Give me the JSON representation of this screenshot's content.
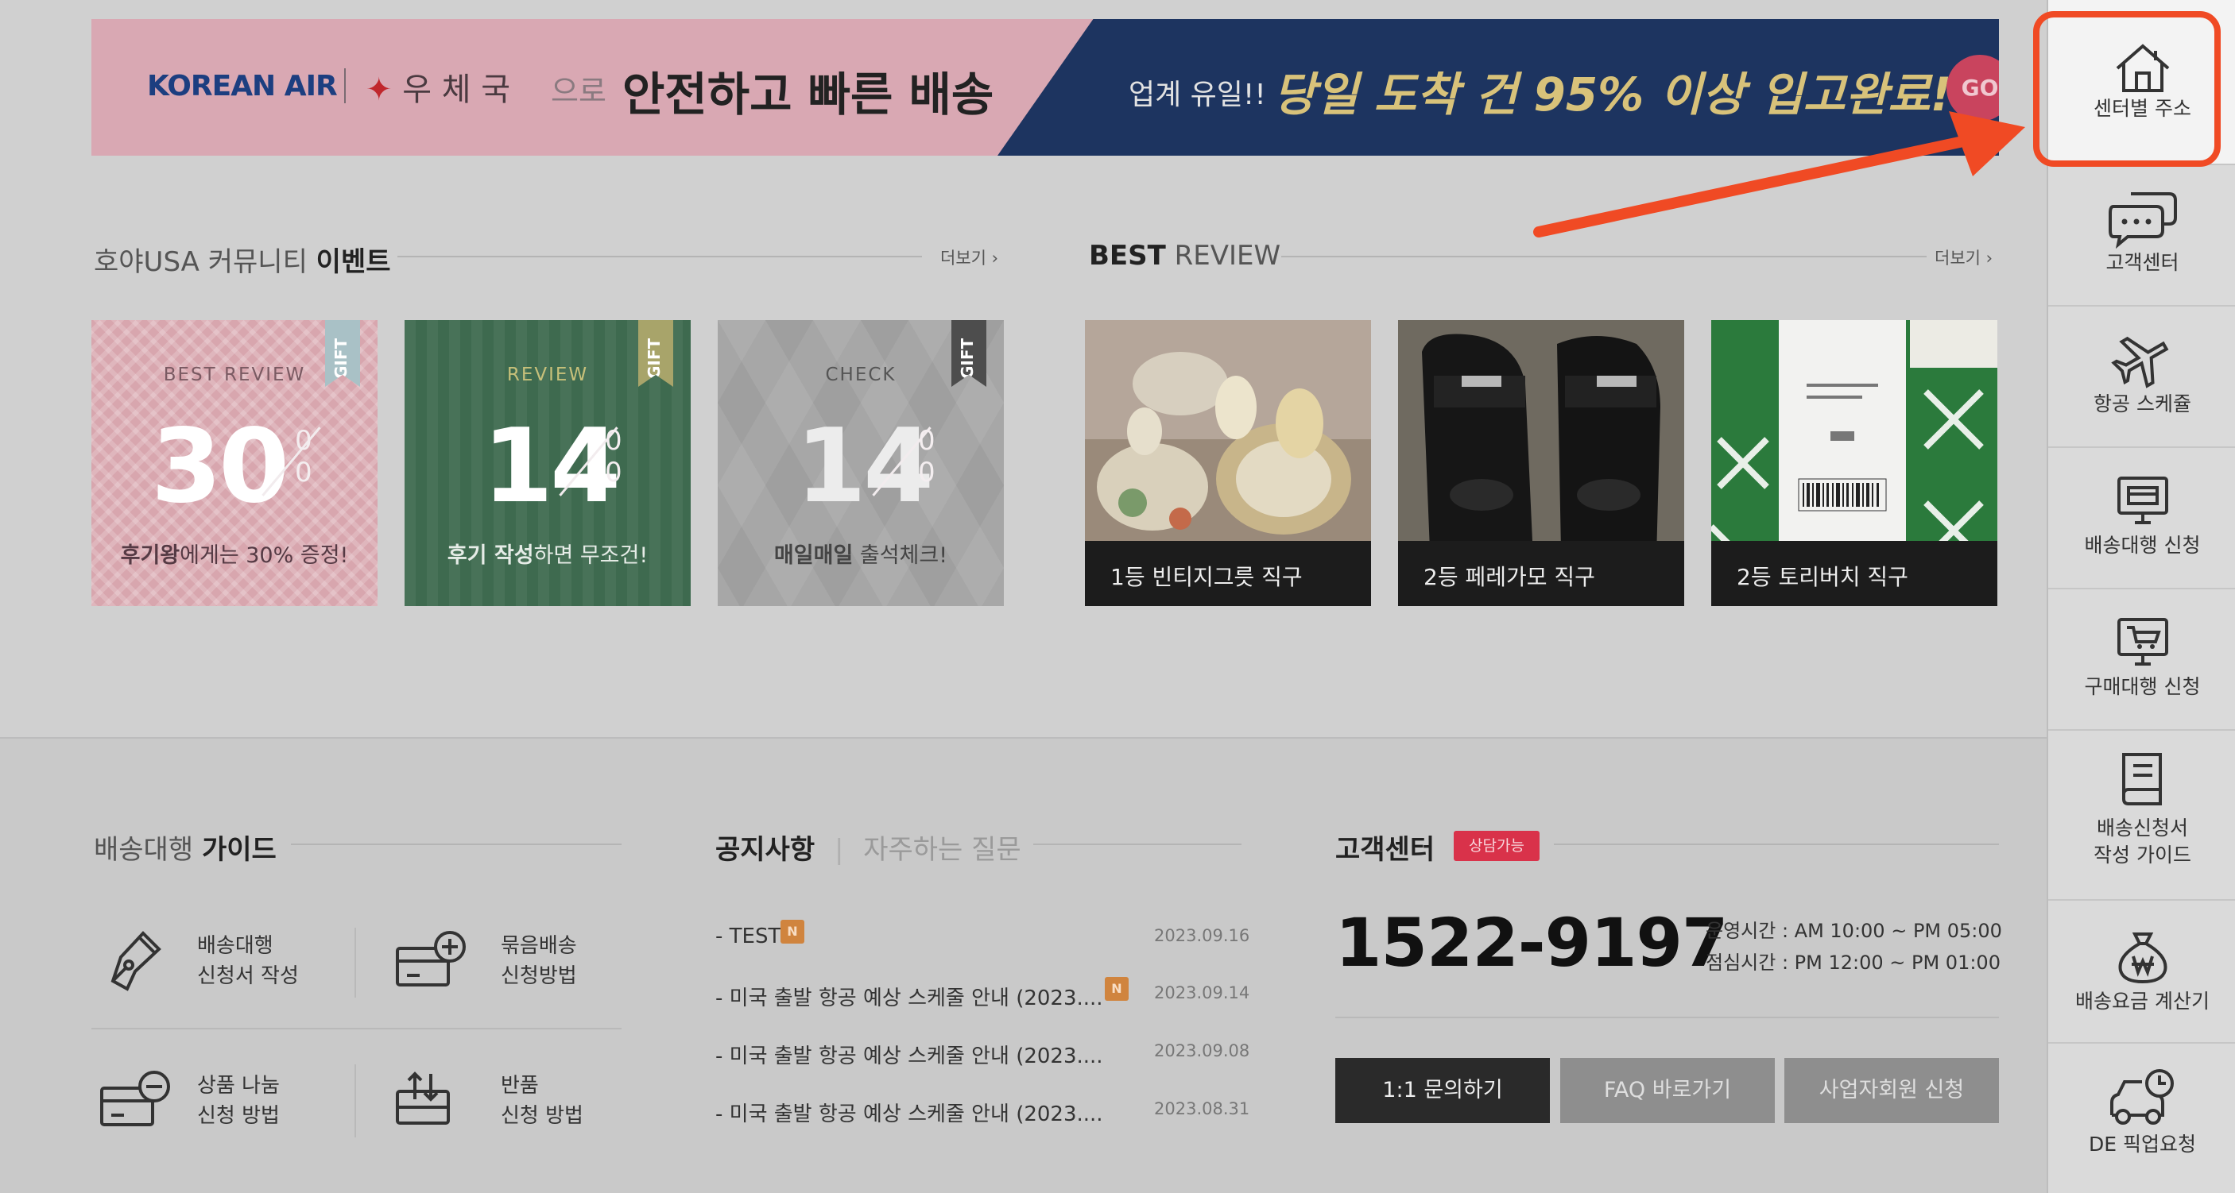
{
  "banner": {
    "korean_air": "KOREAN AIR",
    "post": "우 체 국",
    "euro": "으로",
    "safe": "안전하고 빠른 배송",
    "right_small": "업계 유일!!",
    "right_big": "당일 도착 건 95% 이상 입고완료!",
    "go": "GO"
  },
  "events": {
    "title_light": "호야USA 커뮤니티",
    "title_bold": "이벤트",
    "more": "더보기 ›",
    "cards": [
      {
        "ribbon": "GIFT",
        "top": "BEST REVIEW",
        "big": "30",
        "pct": "0 0",
        "bold": "후기왕",
        "rest": "에게는 30% 증정!"
      },
      {
        "ribbon": "GIFT",
        "top": "REVIEW",
        "big": "14",
        "pct": "0 0",
        "bold": "후기 작성",
        "rest": "하면 무조건!"
      },
      {
        "ribbon": "GIFT",
        "top": "CHECK",
        "big": "14",
        "pct": "0 0",
        "bold": "매일매일",
        "rest": " 출석체크!"
      }
    ]
  },
  "review": {
    "title_bold": "BEST",
    "title_light": "REVIEW",
    "more": "더보기 ›",
    "items": [
      {
        "caption": "1등 빈티지그릇 직구"
      },
      {
        "caption": "2등 페레가모 직구"
      },
      {
        "caption": "2등 토리버치 직구"
      }
    ]
  },
  "sidebar": {
    "items": [
      {
        "label": "센터별 주소",
        "icon": "home-icon"
      },
      {
        "label": "고객센터",
        "icon": "chat-bubble-icon"
      },
      {
        "label": "항공 스케쥴",
        "icon": "airplane-icon"
      },
      {
        "label": "배송대행 신청",
        "icon": "monitor-box-icon"
      },
      {
        "label": "구매대행 신청",
        "icon": "monitor-cart-icon"
      },
      {
        "label1": "배송신청서",
        "label2": "작성 가이드",
        "icon": "book-icon"
      },
      {
        "label": "배송요금 계산기",
        "icon": "money-bag-icon"
      },
      {
        "label": "DE 픽업요청",
        "icon": "pickup-car-icon"
      }
    ]
  },
  "guide": {
    "title_light": "배송대행",
    "title_bold": "가이드",
    "items": [
      {
        "l1": "배송대행",
        "l2": "신청서 작성",
        "icon": "pen-nib-icon"
      },
      {
        "l1": "묶음배송",
        "l2": "신청방법",
        "icon": "box-plus-icon"
      },
      {
        "l1": "상품 나눔",
        "l2": "신청 방법",
        "icon": "box-minus-icon"
      },
      {
        "l1": "반품",
        "l2": "신청 방법",
        "icon": "return-box-icon"
      }
    ]
  },
  "notice": {
    "tab_active": "공지사항",
    "tab_inactive": "자주하는 질문",
    "badge": "N",
    "items": [
      {
        "title": "- TEST",
        "date": "2023.09.16"
      },
      {
        "title": "- 미국 출발 항공 예상 스케줄 안내 (2023....",
        "date": "2023.09.14"
      },
      {
        "title": "- 미국 출발 항공 예상 스케줄 안내 (2023....",
        "date": "2023.09.08"
      },
      {
        "title": "- 미국 출발 항공 예상 스케줄 안내 (2023....",
        "date": "2023.08.31"
      }
    ]
  },
  "cs": {
    "title": "고객센터",
    "badge": "상담가능",
    "phone": "1522-9197",
    "hours1": "운영시간 : AM 10:00 ~ PM 05:00",
    "hours2": "점심시간 : PM 12:00 ~ PM 01:00",
    "btn_inquiry": "1:1 문의하기",
    "btn_faq": "FAQ 바로가기",
    "btn_business": "사업자회원 신청"
  },
  "colors": {
    "highlight": "#f04a24",
    "badge_red": "#d9324a",
    "card_pink": "#d8a6ae",
    "card_green": "#3e6a4f",
    "card_gray": "#a6a6a6"
  }
}
